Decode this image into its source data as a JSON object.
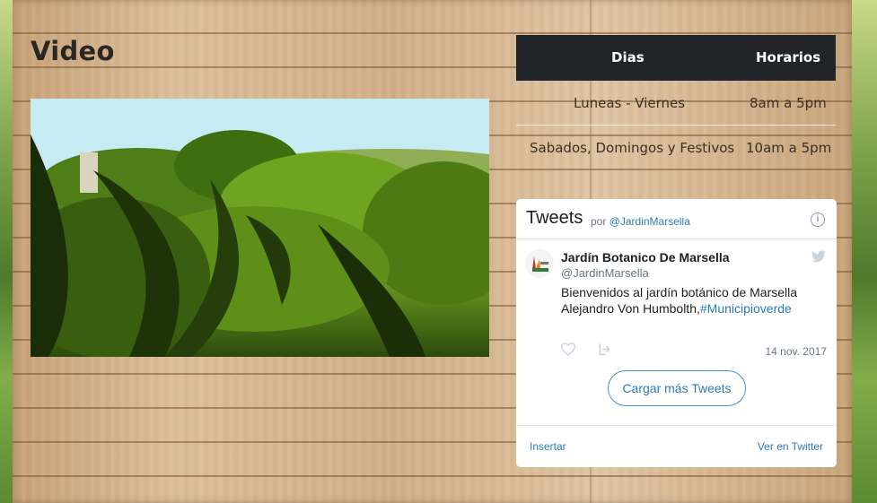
{
  "video_section": {
    "title": "Video"
  },
  "schedule": {
    "headers": [
      "Dias",
      "Horarios"
    ],
    "rows": [
      {
        "days": "Luneas - Viernes",
        "hours": "8am a 5pm"
      },
      {
        "days": "Sabados, Domingos y Festivos",
        "hours": "10am a 5pm"
      }
    ]
  },
  "twitter": {
    "title": "Tweets",
    "by_prefix": "por",
    "by_handle": "@JardinMarsella",
    "info_icon": "info-icon",
    "tweet": {
      "name": "Jardín Botanico De Marsella",
      "handle": "@JardinMarsella",
      "text": "Bienvenidos al jardín botánico de Marsella Alejandro Von Humbolth,",
      "hashtag": "#Municipioverde",
      "date": "14 nov. 2017"
    },
    "load_more": "Cargar más Tweets",
    "embed": "Insertar",
    "view_on": "Ver en Twitter",
    "colors": {
      "link": "#2b7bb9",
      "header_bg": "#212529"
    }
  }
}
